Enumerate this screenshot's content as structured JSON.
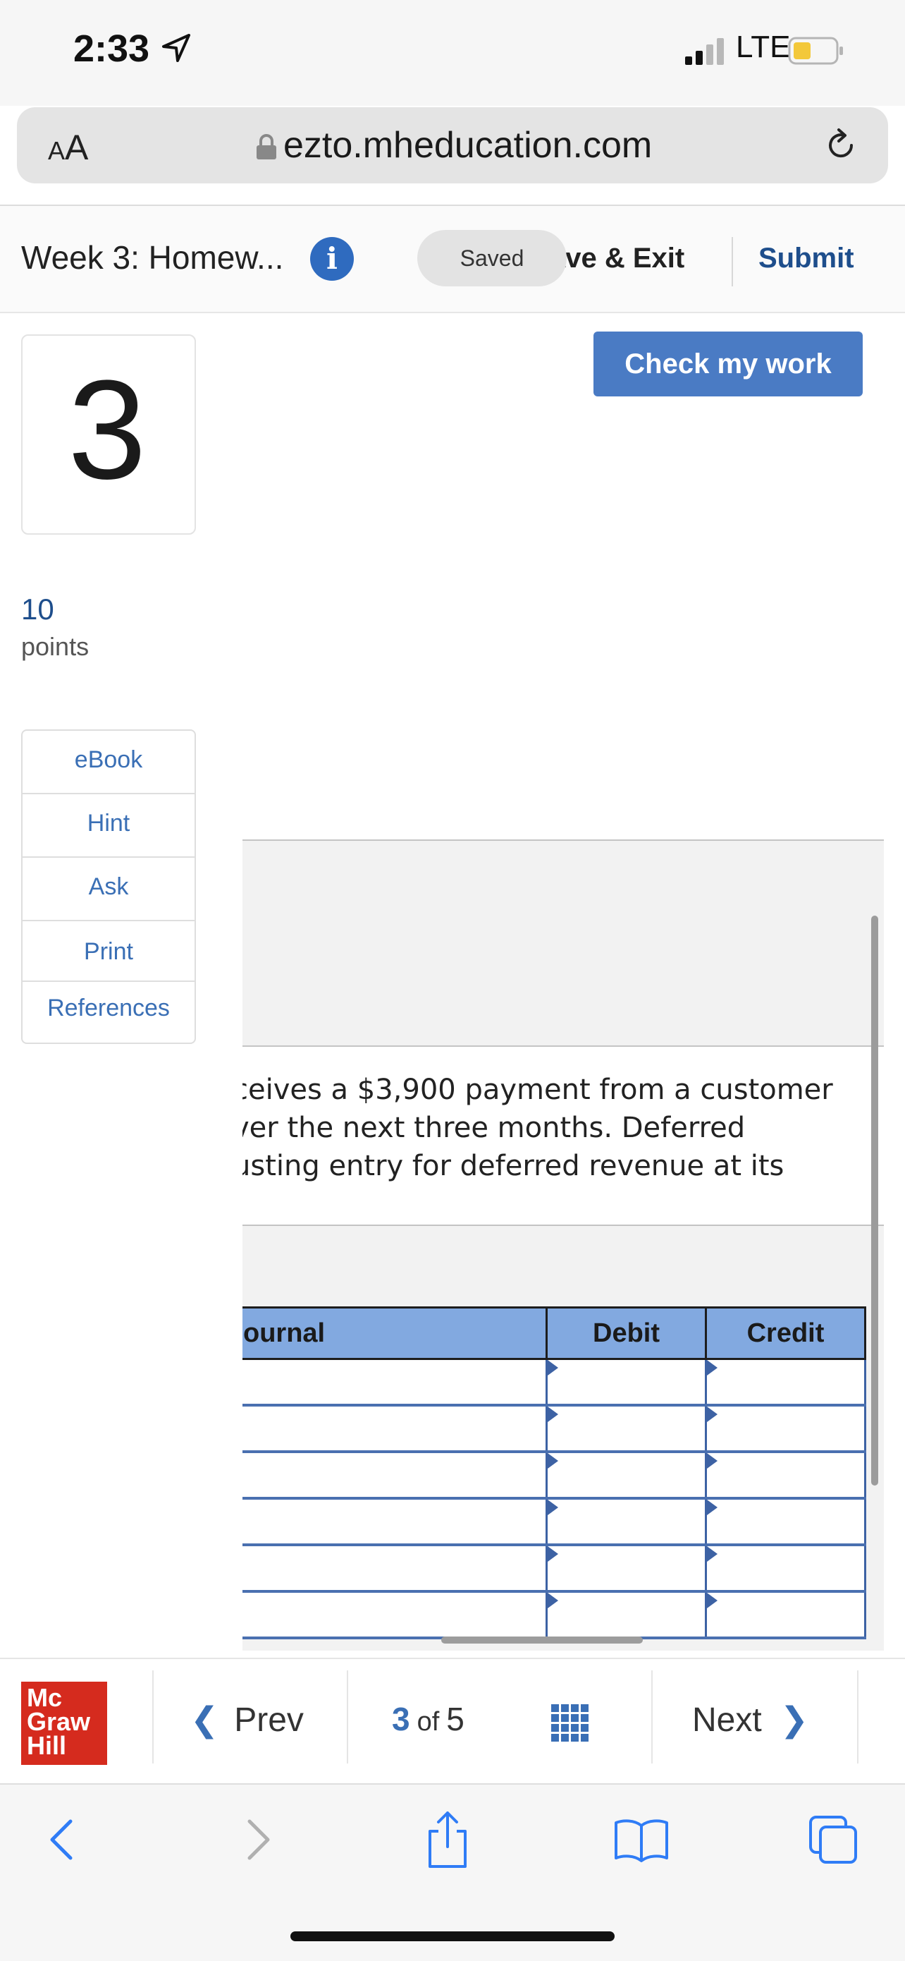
{
  "status_bar": {
    "time": "2:33",
    "network": "LTE"
  },
  "browser": {
    "text_size_label": "AA",
    "url": "ezto.mheducation.com"
  },
  "header": {
    "title": "Week 3: Homew...",
    "saved_label": "Saved",
    "save_exit_label": "ave & Exit",
    "submit_label": "Submit"
  },
  "question": {
    "number": "3",
    "points_value": "10",
    "points_label": "points",
    "check_work_label": "Check my work",
    "text_lines": [
      "ceives a $3,900 payment from a customer",
      "ver the next three months. Deferred",
      "usting entry for deferred revenue at its"
    ]
  },
  "tools": [
    "eBook",
    "Hint",
    "Ask",
    "Print",
    "References"
  ],
  "journal_table": {
    "headers": [
      "ournal",
      "Debit",
      "Credit"
    ],
    "rows": [
      [
        "",
        "",
        ""
      ],
      [
        "",
        "",
        ""
      ],
      [
        "",
        "",
        ""
      ],
      [
        "",
        "",
        ""
      ],
      [
        "",
        "",
        ""
      ],
      [
        "",
        "",
        ""
      ]
    ]
  },
  "nav": {
    "logo_lines": [
      "Mc",
      "Graw",
      "Hill"
    ],
    "prev_label": "Prev",
    "page_current": "3",
    "page_of": "of",
    "page_total": "5",
    "next_label": "Next"
  },
  "colors": {
    "accent": "#4a7bc4",
    "link": "#3a6fb5",
    "table_header": "#82a9e0",
    "logo_red": "#d52b1e"
  },
  "icons": [
    "location-icon",
    "signal-icon",
    "battery-icon",
    "lock-icon",
    "reload-icon",
    "info-icon",
    "grid-icon",
    "back-icon",
    "forward-icon",
    "share-icon",
    "bookmarks-icon",
    "tabs-icon"
  ]
}
